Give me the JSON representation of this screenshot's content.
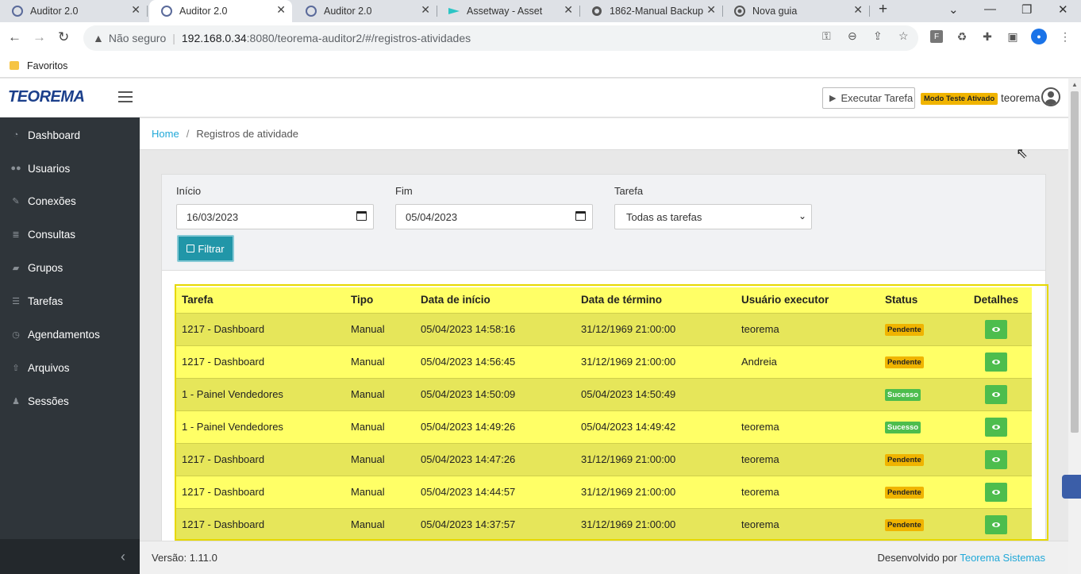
{
  "browser": {
    "tabs": [
      {
        "title": "Auditor 2.0",
        "icon": "teorema-icon",
        "active": false
      },
      {
        "title": "Auditor 2.0",
        "icon": "teorema-icon",
        "active": true
      },
      {
        "title": "Auditor 2.0",
        "icon": "teorema-icon",
        "active": false
      },
      {
        "title": "Assetway - Asset",
        "icon": "assetway-icon",
        "active": false
      },
      {
        "title": "1862-Manual Backup",
        "icon": "globe-icon",
        "active": false
      },
      {
        "title": "Nova guia",
        "icon": "chrome-icon",
        "active": false
      }
    ],
    "security_label": "Não seguro",
    "url_host": "192.168.0.34",
    "url_rest": ":8080/teorema-auditor2/#/registros-atividades",
    "bookmark_folder": "Favoritos"
  },
  "header": {
    "logo_text": "TEOREMA",
    "execute_label": "Executar Tarefa",
    "mode_badge": "Modo Teste Ativado",
    "username": "teorema"
  },
  "sidebar": {
    "items": [
      {
        "label": "Dashboard",
        "icon": "dashboard-icon"
      },
      {
        "label": "Usuarios",
        "icon": "users-icon"
      },
      {
        "label": "Conexões",
        "icon": "plug-icon"
      },
      {
        "label": "Consultas",
        "icon": "database-icon"
      },
      {
        "label": "Grupos",
        "icon": "folder-icon"
      },
      {
        "label": "Tarefas",
        "icon": "list-icon"
      },
      {
        "label": "Agendamentos",
        "icon": "clock-icon"
      },
      {
        "label": "Arquivos",
        "icon": "upload-icon"
      },
      {
        "label": "Sessões",
        "icon": "user-icon"
      }
    ]
  },
  "breadcrumb": {
    "home": "Home",
    "separator": "/",
    "current": "Registros de atividade"
  },
  "filter": {
    "start_label": "Início",
    "start_value": "16/03/2023",
    "end_label": "Fim",
    "end_value": "05/04/2023",
    "task_label": "Tarefa",
    "task_value": "Todas as tarefas",
    "filter_button": "Filtrar"
  },
  "table": {
    "headers": [
      "Tarefa",
      "Tipo",
      "Data de início",
      "Data de término",
      "Usuário executor",
      "Status",
      "Detalhes"
    ],
    "rows": [
      {
        "tarefa": "1217 - Dashboard",
        "tipo": "Manual",
        "inicio": "05/04/2023 14:58:16",
        "termino": "31/12/1969 21:00:00",
        "usuario": "teorema",
        "status": "Pendente"
      },
      {
        "tarefa": "1217 - Dashboard",
        "tipo": "Manual",
        "inicio": "05/04/2023 14:56:45",
        "termino": "31/12/1969 21:00:00",
        "usuario": "Andreia",
        "status": "Pendente"
      },
      {
        "tarefa": "1 - Painel Vendedores",
        "tipo": "Manual",
        "inicio": "05/04/2023 14:50:09",
        "termino": "05/04/2023 14:50:49",
        "usuario": "",
        "status": "Sucesso"
      },
      {
        "tarefa": "1 - Painel Vendedores",
        "tipo": "Manual",
        "inicio": "05/04/2023 14:49:26",
        "termino": "05/04/2023 14:49:42",
        "usuario": "teorema",
        "status": "Sucesso"
      },
      {
        "tarefa": "1217 - Dashboard",
        "tipo": "Manual",
        "inicio": "05/04/2023 14:47:26",
        "termino": "31/12/1969 21:00:00",
        "usuario": "teorema",
        "status": "Pendente"
      },
      {
        "tarefa": "1217 - Dashboard",
        "tipo": "Manual",
        "inicio": "05/04/2023 14:44:57",
        "termino": "31/12/1969 21:00:00",
        "usuario": "teorema",
        "status": "Pendente"
      },
      {
        "tarefa": "1217 - Dashboard",
        "tipo": "Manual",
        "inicio": "05/04/2023 14:37:57",
        "termino": "31/12/1969 21:00:00",
        "usuario": "teorema",
        "status": "Pendente"
      }
    ]
  },
  "footer": {
    "version": "Versão: 1.11.0",
    "dev_prefix": "Desenvolvido por",
    "dev_link": "Teorema Sistemas"
  },
  "colors": {
    "sidebar_bg": "#2f353a",
    "accent": "#20a8d8",
    "filter_button": "#2196a8",
    "status_pending": "#f0b400",
    "status_success": "#4dbd4d",
    "highlight_row": "#ffff66"
  }
}
